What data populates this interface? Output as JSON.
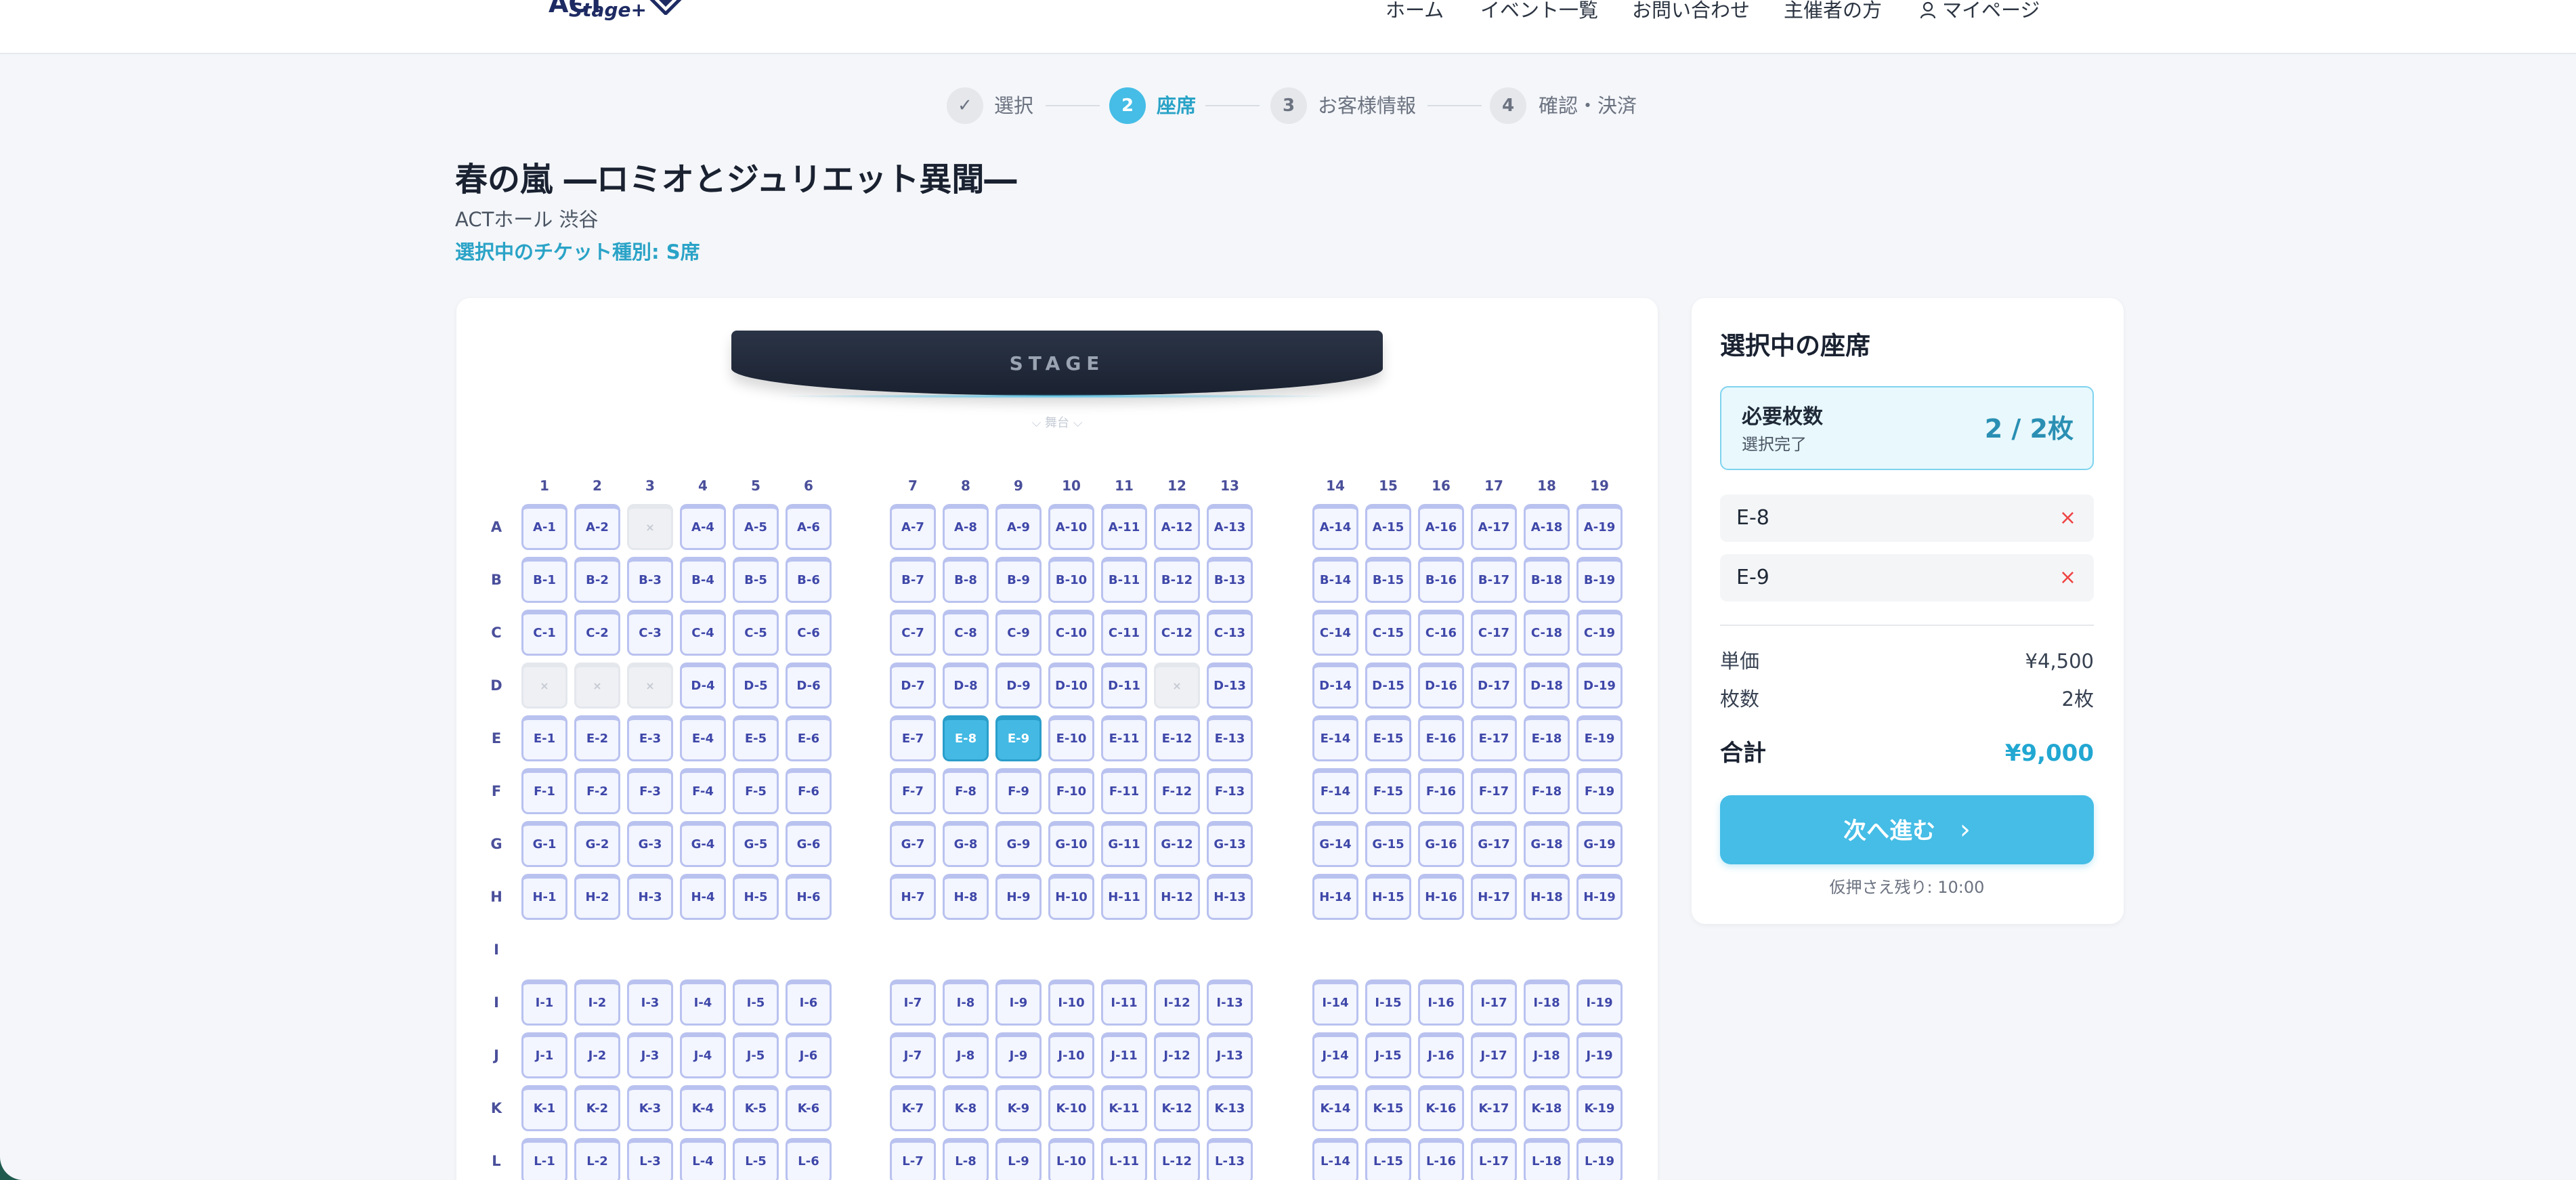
{
  "header": {
    "logo_text": "ACT",
    "logo_sub": "Stage+",
    "nav": [
      "ホーム",
      "イベント一覧",
      "お問い合わせ",
      "主催者の方",
      "マイページ"
    ]
  },
  "stepper": [
    {
      "num": "✓",
      "label": "選択",
      "state": "done"
    },
    {
      "num": "2",
      "label": "座席",
      "state": "active"
    },
    {
      "num": "3",
      "label": "お客様情報",
      "state": "todo"
    },
    {
      "num": "4",
      "label": "確認・決済",
      "state": "todo"
    }
  ],
  "event": {
    "title": "春の嵐 ―ロミオとジュリエット異聞―",
    "venue": "ACTホール 渋谷",
    "ticket_type": "選択中のチケット種別: S席"
  },
  "seatmap": {
    "stage_label": "STAGE",
    "stage_sub": "舞台",
    "rows": [
      "A",
      "B",
      "C",
      "D",
      "E",
      "F",
      "G",
      "H",
      "I",
      "I",
      "J",
      "K",
      "L"
    ],
    "cols": [
      1,
      2,
      3,
      4,
      5,
      6,
      7,
      8,
      9,
      10,
      11,
      12,
      13,
      14,
      15,
      16,
      17,
      18,
      19
    ],
    "taken_label": "×",
    "taken": [
      "A-3",
      "D-1",
      "D-2",
      "D-3",
      "D-12"
    ],
    "selected": [
      "E-8",
      "E-9"
    ]
  },
  "panel": {
    "title": "選択中の座席",
    "required_label": "必要枚数",
    "required_status": "選択完了",
    "required_count": "2 / 2枚",
    "selected_seats": [
      "E-8",
      "E-9"
    ],
    "remove_icon": "×",
    "unit_price_label": "単価",
    "unit_price": "¥4,500",
    "qty_label": "枚数",
    "qty": "2枚",
    "total_label": "合計",
    "total": "¥9,000",
    "next_label": "次へ進む",
    "next_icon": "›",
    "hold_note": "仮押さえ残り: 10:00"
  },
  "colors": {
    "accent": "#45bde6",
    "brand": "#1e2b63",
    "seat_border": "#b9c2ef",
    "seat_text": "#3e47a8",
    "danger": "#ef4444"
  }
}
